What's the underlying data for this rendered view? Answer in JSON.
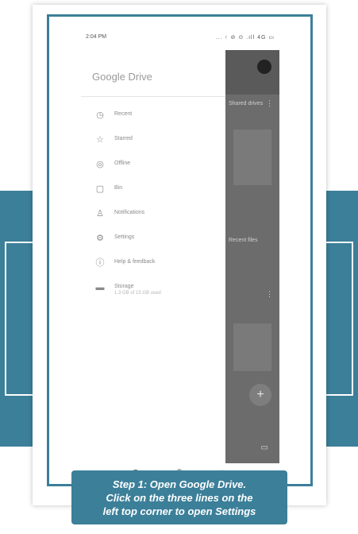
{
  "status_bar": {
    "time": "2:04 PM",
    "icons": "... ↑ ⊘ ⊙ .ıll 4G ▭"
  },
  "drawer": {
    "title": "Google Drive",
    "menu": [
      {
        "icon": "clock-icon",
        "glyph": "◷",
        "label": "Recent"
      },
      {
        "icon": "star-icon",
        "glyph": "☆",
        "label": "Starred"
      },
      {
        "icon": "offline-icon",
        "glyph": "◎",
        "label": "Offline"
      },
      {
        "icon": "bin-icon",
        "glyph": "▢",
        "label": "Bin"
      },
      {
        "icon": "bell-icon",
        "glyph": "♙",
        "label": "Notifications"
      },
      {
        "icon": "gear-icon",
        "glyph": "⚙",
        "label": "Settings"
      },
      {
        "icon": "help-icon",
        "glyph": "ⓘ",
        "label": "Help & feedback"
      },
      {
        "icon": "storage-icon",
        "glyph": "▬",
        "label": "Storage",
        "sub": "1.3 GB of 15 GB used"
      }
    ]
  },
  "background_app": {
    "row1": "Shared drives",
    "row2": "Recent files"
  },
  "nav": {
    "recents": "■",
    "home": "◉",
    "back": "◂"
  },
  "caption": {
    "line1": "Step 1: Open Google Drive.",
    "line2": "Click on the three lines on the",
    "line3": "left top corner to open Settings"
  },
  "colors": {
    "accent": "#3c7f99",
    "dim": "#6c6c6c"
  }
}
